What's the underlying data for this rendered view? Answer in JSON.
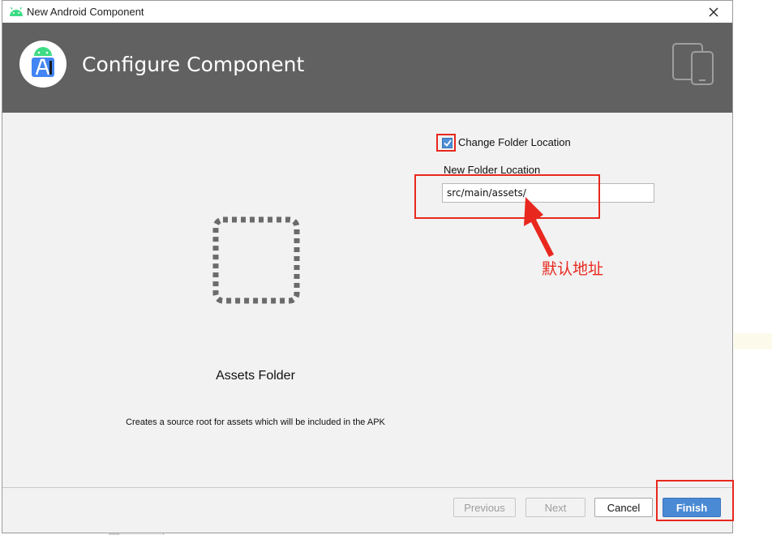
{
  "window": {
    "title": "New Android Component",
    "title_icon": "android-robot-icon",
    "close_icon": "close-icon"
  },
  "header": {
    "title": "Configure Component",
    "logo_icon": "android-studio-logo-icon",
    "device_icon": "tablet-phone-icon",
    "background": "#616161"
  },
  "component": {
    "name": "Assets Folder",
    "description": "Creates a source root for assets which will be included in the APK",
    "illustration_icon": "dashed-folder-icon"
  },
  "form": {
    "change_folder_checked": true,
    "change_folder_label": "Change Folder Location",
    "new_folder_label": "New Folder Location",
    "new_folder_value": "src/main/assets/"
  },
  "annotation": {
    "text": "默认地址",
    "color": "#e8281e"
  },
  "buttons": {
    "previous": "Previous",
    "next": "Next",
    "cancel": "Cancel",
    "finish": "Finish"
  },
  "colors": {
    "accent": "#4a89d4",
    "dialog_bg": "#f2f2f2"
  }
}
